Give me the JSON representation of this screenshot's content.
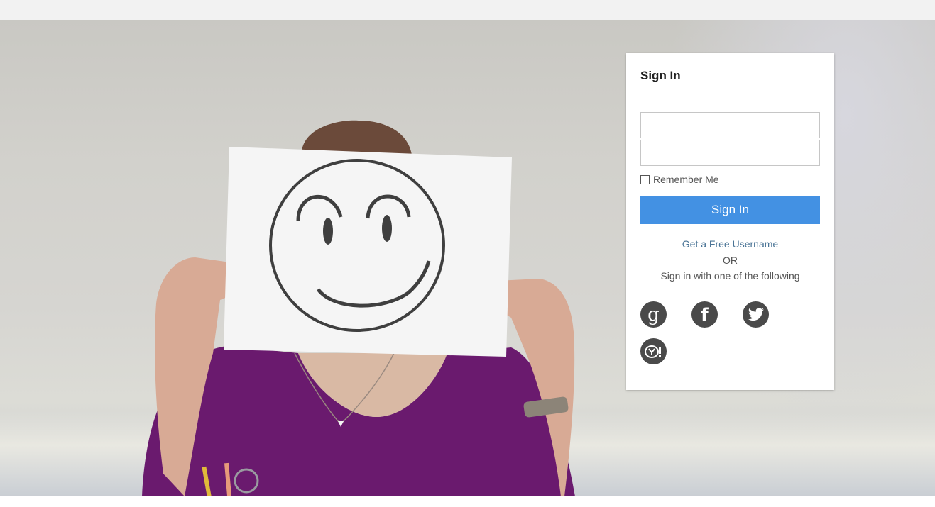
{
  "signin": {
    "title": "Sign In",
    "username_value": "",
    "password_value": "",
    "remember_label": "Remember Me",
    "remember_checked": false,
    "button_label": "Sign In",
    "free_username_link": "Get a Free Username",
    "or_label": "OR",
    "alt_signin_text": "Sign in with one of the following",
    "social_providers": [
      {
        "name": "google",
        "icon": "google-icon",
        "glyph": "g"
      },
      {
        "name": "facebook",
        "icon": "facebook-icon",
        "glyph": "f"
      },
      {
        "name": "twitter",
        "icon": "twitter-icon"
      },
      {
        "name": "yahoo",
        "icon": "yahoo-icon"
      }
    ]
  },
  "colors": {
    "accent": "#4391e3",
    "link": "#4a7496",
    "social_icon_bg": "#4a4a4a",
    "topbar_bg": "#f2f2f2"
  }
}
